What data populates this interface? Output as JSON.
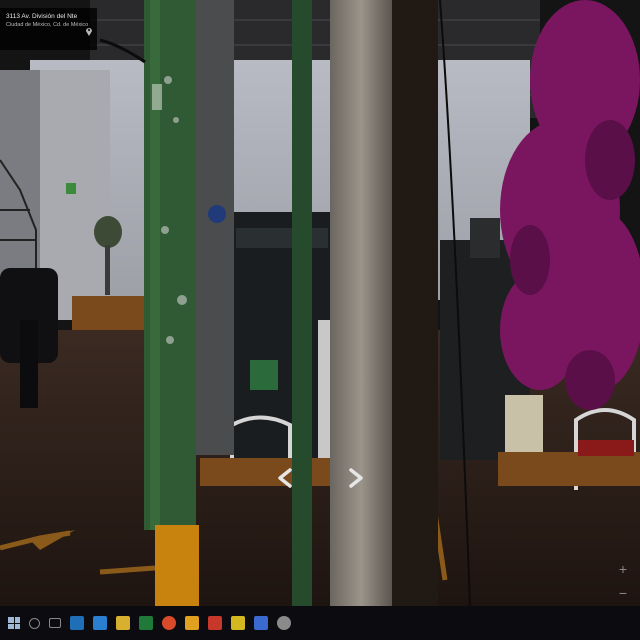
{
  "location": {
    "street_line": "3113 Av. División del Nte",
    "city_line": "Ciudad de México, Cd. de México"
  },
  "controls": {
    "zoom_in_label": "+",
    "zoom_out_label": "−",
    "prev_arrow": "chevron-left-icon",
    "next_arrow": "chevron-right-icon"
  },
  "taskbar": {
    "icons": [
      "start-icon",
      "search-icon",
      "task-view-icon",
      "store-icon",
      "mail-icon",
      "folder-icon",
      "excel-icon",
      "chrome-icon",
      "word-icon",
      "powerpoint-icon",
      "app-icon",
      "paint-icon",
      "browser-icon"
    ]
  },
  "colors": {
    "taskbar_bg": "#0b0b10",
    "pole_green": "#3a6a3a",
    "bougainvillea": "#7a1660"
  }
}
